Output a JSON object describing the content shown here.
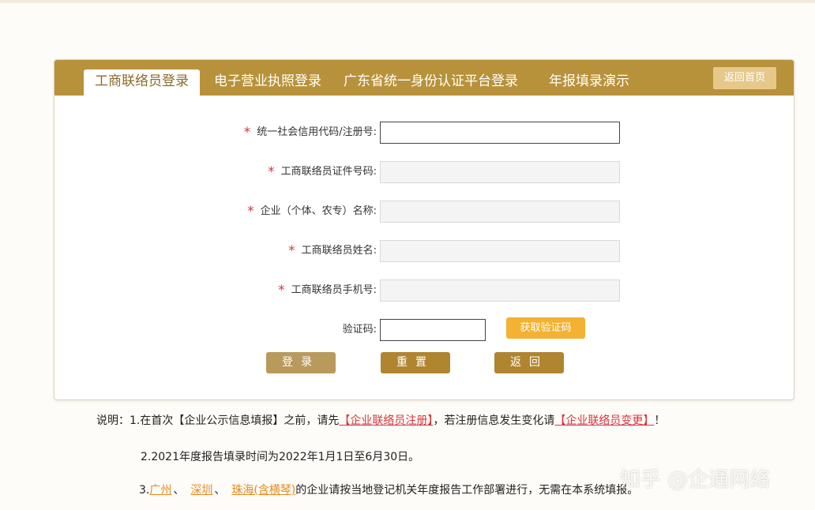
{
  "tabs": [
    {
      "label": "工商联络员登录",
      "active": true
    },
    {
      "label": "电子营业执照登录",
      "active": false
    },
    {
      "label": "广东省统一身份认证平台登录",
      "active": false
    },
    {
      "label": "年报填录演示",
      "active": false
    }
  ],
  "home_button": "返回首页",
  "form": {
    "credit_code_label": "统一社会信用代码/注册号:",
    "id_number_label": "工商联络员证件号码:",
    "enterprise_name_label": "企业（个体、农专）名称:",
    "contact_name_label": "工商联络员姓名:",
    "phone_label": "工商联络员手机号:",
    "captcha_label": "验证码:",
    "get_code_button": "获取验证码",
    "required_mark": "*"
  },
  "actions": {
    "login": "登录",
    "reset": "重置",
    "back": "返回"
  },
  "notes": {
    "line1_prefix": "说明：1.在首次【企业公示信息填报】之前，请先",
    "line1_link1": "【企业联络员注册】",
    "line1_middle": "，若注册信息发生变化请",
    "line1_link2": "【企业联络员变更】",
    "line1_suffix": "！",
    "line2": "2.2021年度报告填录时间为2022年1月1日至6月30日。",
    "line3_prefix": "3.",
    "line3_link1": "广州",
    "line3_sep1": "、",
    "line3_link2": "深圳",
    "line3_sep2": "、",
    "line3_link3": "珠海(含横琴)",
    "line3_suffix": "的企业请按当地登记机关年度报告工作部署进行，无需在本系统填报。"
  },
  "watermark": "知乎 @企通网络",
  "colors": {
    "tab_bar": "#b8923a",
    "required_star": "#d9363e",
    "get_code": "#f3b233",
    "login_button": "#b89a5c",
    "reset_button": "#b08530",
    "back_button": "#b08530"
  }
}
